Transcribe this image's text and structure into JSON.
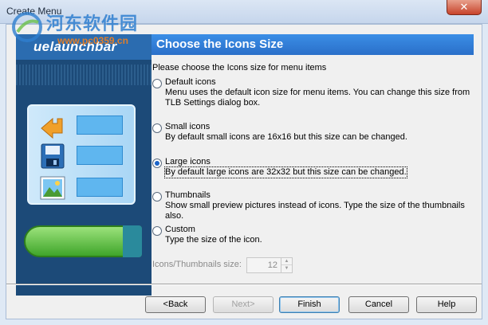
{
  "window": {
    "title": "Create Menu",
    "close_label": "✕"
  },
  "watermark": {
    "text": "河东软件园",
    "url": "www.pc0359.cn"
  },
  "banner": {
    "product_name": "uelaunchbar"
  },
  "header": {
    "title": "Choose the Icons Size"
  },
  "prompt": "Please choose the Icons size for menu items",
  "options": [
    {
      "label": "Default icons",
      "desc": "Menu uses the default icon size for menu items. You can change this size from TLB Settings dialog box.",
      "selected": false
    },
    {
      "label": "Small icons",
      "desc": "By default small icons are 16x16 but this size can be changed.",
      "selected": false
    },
    {
      "label": "Large icons",
      "desc": "By default large icons are 32x32 but this size can be changed.",
      "selected": true
    },
    {
      "label": "Thumbnails",
      "desc": "Show small preview pictures instead of icons. Type the size of the thumbnails also.",
      "selected": false
    },
    {
      "label": "Custom",
      "desc": "Type the size of the icon.",
      "selected": false
    }
  ],
  "size_field": {
    "label": "Icons/Thumbnails size:",
    "value": "12"
  },
  "buttons": {
    "back": "<Back",
    "next": "Next>",
    "finish": "Finish",
    "cancel": "Cancel",
    "help": "Help"
  },
  "colors": {
    "accent": "#2a6fc9",
    "radio_dot": "#1b64c8"
  }
}
